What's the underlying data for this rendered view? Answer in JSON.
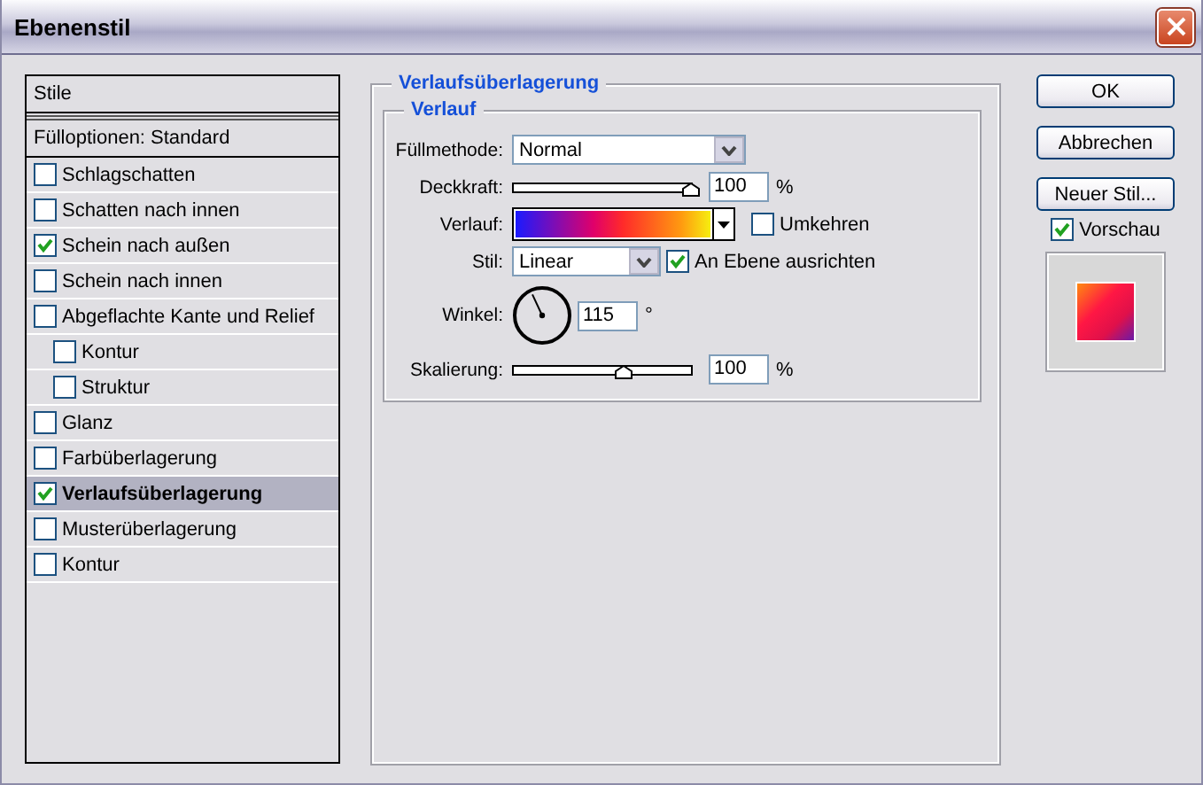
{
  "window": {
    "title": "Ebenenstil"
  },
  "styles_list": {
    "header": "Stile",
    "blending_options": "Fülloptionen: Standard",
    "items": [
      {
        "label": "Schlagschatten",
        "checked": false,
        "selected": false
      },
      {
        "label": "Schatten nach innen",
        "checked": false,
        "selected": false
      },
      {
        "label": "Schein nach außen",
        "checked": true,
        "selected": false
      },
      {
        "label": "Schein nach innen",
        "checked": false,
        "selected": false
      },
      {
        "label": "Abgeflachte Kante und Relief",
        "checked": false,
        "selected": false,
        "children": [
          {
            "label": "Kontur",
            "checked": false,
            "selected": false
          },
          {
            "label": "Struktur",
            "checked": false,
            "selected": false
          }
        ]
      },
      {
        "label": "Glanz",
        "checked": false,
        "selected": false
      },
      {
        "label": "Farbüberlagerung",
        "checked": false,
        "selected": false
      },
      {
        "label": "Verlaufsüberlagerung",
        "checked": true,
        "selected": true
      },
      {
        "label": "Musterüberlagerung",
        "checked": false,
        "selected": false
      },
      {
        "label": "Kontur",
        "checked": false,
        "selected": false
      }
    ]
  },
  "panel": {
    "title": "Verlaufsüberlagerung",
    "group": {
      "title": "Verlauf",
      "rows": [
        {
          "kind": "select",
          "label": "Füllmethode:",
          "value": "Normal"
        },
        {
          "kind": "slider",
          "label": "Deckkraft:",
          "level": 1,
          "value": "100",
          "unit": "%"
        },
        {
          "kind": "gradient",
          "label": "Verlauf:",
          "option": {
            "label": "Umkehren",
            "checked": false
          }
        },
        {
          "kind": "select",
          "label": "Stil:",
          "value": "Linear",
          "option": {
            "label": "An Ebene ausrichten",
            "checked": true
          }
        },
        {
          "kind": "dial",
          "label": "Winkel:",
          "value": "115",
          "unit": "°"
        },
        {
          "kind": "slider",
          "label": "Skalierung:",
          "level": 0.62,
          "value": "100",
          "unit": "%"
        }
      ]
    }
  },
  "buttons": [
    {
      "label": "OK"
    },
    {
      "label": "Abbrechen"
    },
    {
      "label": "Neuer Stil..."
    }
  ],
  "preview": {
    "label": "Vorschau",
    "checked": true
  }
}
